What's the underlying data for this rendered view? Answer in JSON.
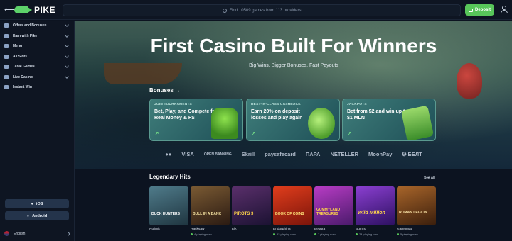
{
  "header": {
    "logo_text": "PIKE",
    "search_placeholder": "Find 10509 games from 113 providers",
    "deposit_label": "Deposit"
  },
  "sidebar": {
    "items": [
      {
        "label": "Offers and Bonuses",
        "icon": "gift-icon",
        "chevron": true
      },
      {
        "label": "Earn with Pike",
        "icon": "coin-icon",
        "chevron": true
      },
      {
        "label": "Menu",
        "icon": "menu-icon",
        "chevron": true
      },
      {
        "label": "All Slots",
        "icon": "slots-icon",
        "chevron": true
      },
      {
        "label": "Table Games",
        "icon": "cards-icon",
        "chevron": true
      },
      {
        "label": "Live Casino",
        "icon": "live-icon",
        "chevron": true
      },
      {
        "label": "Instant Win",
        "icon": "instant-icon",
        "chevron": false
      }
    ],
    "ios_label": "iOS",
    "android_label": "Android",
    "language": "English"
  },
  "hero": {
    "title": "First Casino Built For Winners",
    "subtitle": "Big Wins, Bigger Bonuses, Fast Payouts"
  },
  "bonuses": {
    "title": "Bonuses →",
    "cards": [
      {
        "tag": "JOIN TOURNAMENTS",
        "text": "Bet, Play, and Compete for Real Money & FS"
      },
      {
        "tag": "BEST-IN-CLASS CASHBACK",
        "text": "Earn 20% on deposit losses and play again"
      },
      {
        "tag": "JACKPOTS",
        "text": "Bet from $2 and win up to $1 MLN"
      }
    ]
  },
  "payments": [
    "●●",
    "VISA",
    "OPEN BANKING",
    "Skrill",
    "paysafecard",
    "ПАРА",
    "NETELLER",
    "MoonPay",
    "Ꝋ БЕЛТ"
  ],
  "games": {
    "title": "Legendary Hits",
    "see_all": "See All",
    "items": [
      {
        "title": "DUCK HUNTERS",
        "provider": "Nolimit",
        "players": ""
      },
      {
        "title": "BULL IN A BANK",
        "provider": "Hacksaw",
        "players": "4 playing now"
      },
      {
        "title": "PIROTS 3",
        "provider": "Elk",
        "players": ""
      },
      {
        "title": "BOOK OF COINS",
        "provider": "Endorphina",
        "players": "52 playing now"
      },
      {
        "title": "GUMMYLAND TREASURES",
        "provider": "Belatra",
        "players": "7 playing now"
      },
      {
        "title": "Wild Million",
        "provider": "Bgmng",
        "players": "24 playing now"
      },
      {
        "title": "ROMAN LEGION",
        "provider": "Gamomat",
        "players": "5 playing now"
      }
    ]
  },
  "colors": {
    "accent": "#58c65a",
    "bg": "#0c1320"
  }
}
